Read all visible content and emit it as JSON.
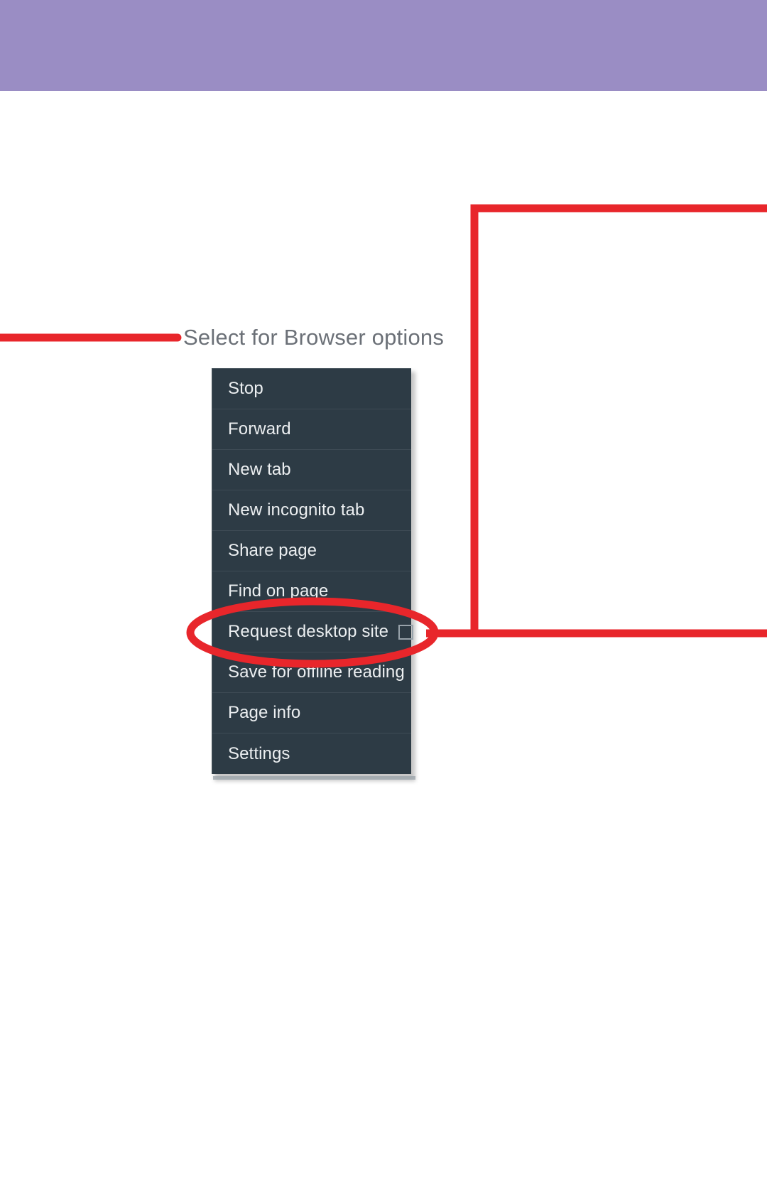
{
  "theme": {
    "header_band_color": "#9a8dc4",
    "menu_background": "#2d3b45",
    "menu_text_color": "#eceff1",
    "annotation_color": "#e8262b",
    "caption_color": "#6b7077",
    "page_background": "#ffffff"
  },
  "annotation": {
    "caption": "Select for Browser options",
    "highlight_target": "Request desktop site",
    "pointer_line_icon": "leader-line",
    "highlight_shape_icon": "ellipse-highlight"
  },
  "menu": {
    "name": "browser-options-menu",
    "items": [
      {
        "label": "Stop",
        "has_checkbox": false
      },
      {
        "label": "Forward",
        "has_checkbox": false
      },
      {
        "label": "New tab",
        "has_checkbox": false
      },
      {
        "label": "New incognito tab",
        "has_checkbox": false
      },
      {
        "label": "Share page",
        "has_checkbox": false
      },
      {
        "label": "Find on page",
        "has_checkbox": false
      },
      {
        "label": "Request desktop site",
        "has_checkbox": true,
        "checked": false
      },
      {
        "label": "Save for offline reading",
        "has_checkbox": false
      },
      {
        "label": "Page info",
        "has_checkbox": false
      },
      {
        "label": "Settings",
        "has_checkbox": false
      }
    ]
  }
}
